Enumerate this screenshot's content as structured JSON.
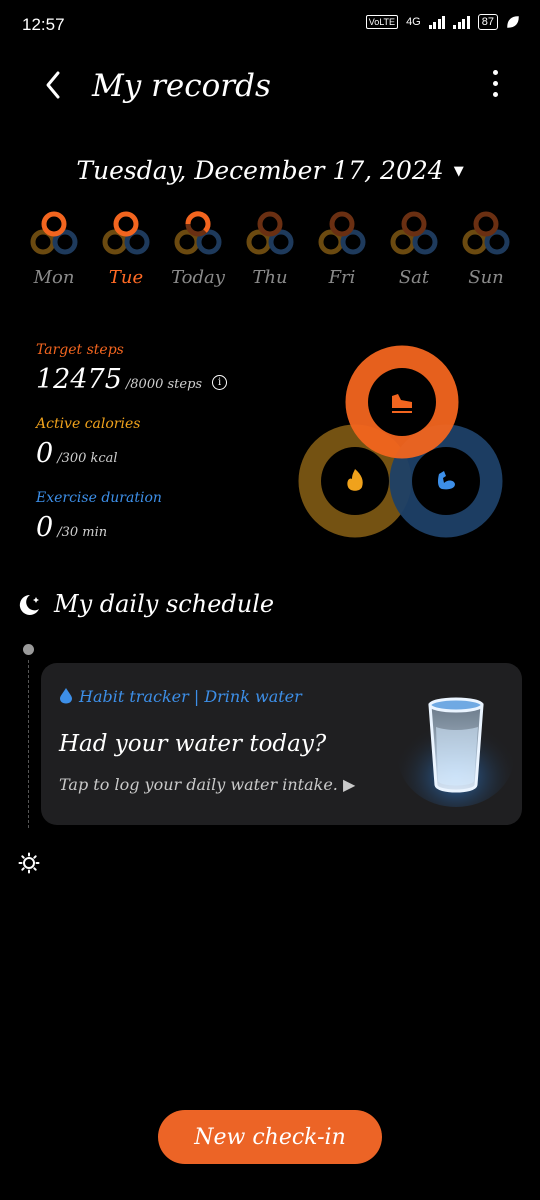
{
  "status_bar": {
    "time": "12:57",
    "volte": "VoLTE",
    "network": "4G",
    "battery": "87"
  },
  "header": {
    "title": "My records"
  },
  "date": {
    "label": "Tuesday, December 17, 2024"
  },
  "week": [
    {
      "label": "Mon",
      "selected": false
    },
    {
      "label": "Tue",
      "selected": true
    },
    {
      "label": "Today",
      "selected": false
    },
    {
      "label": "Thu",
      "selected": false
    },
    {
      "label": "Fri",
      "selected": false
    },
    {
      "label": "Sat",
      "selected": false
    },
    {
      "label": "Sun",
      "selected": false
    }
  ],
  "stats": {
    "steps": {
      "label": "Target steps",
      "value": "12475",
      "unit": "/8000 steps"
    },
    "calories": {
      "label": "Active calories",
      "value": "0",
      "unit": "/300 kcal"
    },
    "duration": {
      "label": "Exercise duration",
      "value": "0",
      "unit": "/30 min"
    }
  },
  "schedule": {
    "title": "My daily schedule",
    "card": {
      "tag": "Habit tracker | Drink water",
      "headline": "Had your water today?",
      "subtitle": "Tap to log your daily water intake. ▶"
    }
  },
  "cta": {
    "label": "New check-in"
  },
  "colors": {
    "accent_orange": "#ec6426",
    "steps": "#f2651f",
    "calories": "#f0a21c",
    "duration": "#3d8fe8",
    "background": "#000000",
    "card": "#1f1f21"
  }
}
